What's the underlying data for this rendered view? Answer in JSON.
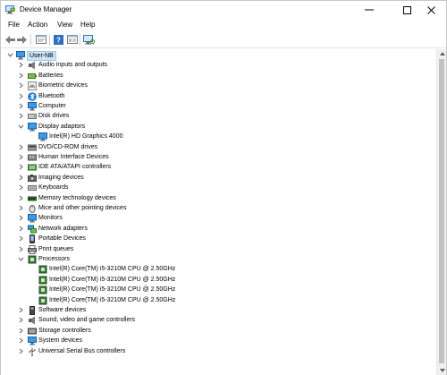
{
  "window": {
    "title": "Device Manager"
  },
  "menu": {
    "file": "File",
    "action": "Action",
    "view": "View",
    "help": "Help"
  },
  "tree": {
    "root": "User-NB",
    "categories": [
      {
        "label": "Audio inputs and outputs",
        "icon": "speaker-icon",
        "expanded": false
      },
      {
        "label": "Batteries",
        "icon": "battery-icon",
        "expanded": false
      },
      {
        "label": "Biometric devices",
        "icon": "fingerprint-icon",
        "expanded": false
      },
      {
        "label": "Bluetooth",
        "icon": "bluetooth-icon",
        "expanded": false
      },
      {
        "label": "Computer",
        "icon": "computer-icon",
        "expanded": false
      },
      {
        "label": "Disk drives",
        "icon": "disk-drive-icon",
        "expanded": false
      },
      {
        "label": "Display adaptors",
        "icon": "monitor-icon",
        "expanded": true,
        "children": [
          "Intel(R) HD Graphics 4000"
        ]
      },
      {
        "label": "DVD/CD-ROM drives",
        "icon": "optical-drive-icon",
        "expanded": false
      },
      {
        "label": "Human Interface Devices",
        "icon": "hid-icon",
        "expanded": false
      },
      {
        "label": "IDE ATA/ATAPI controllers",
        "icon": "ide-controller-icon",
        "expanded": false
      },
      {
        "label": "Imaging devices",
        "icon": "camera-icon",
        "expanded": false
      },
      {
        "label": "Keyboards",
        "icon": "keyboard-icon",
        "expanded": false
      },
      {
        "label": "Memory technology devices",
        "icon": "memory-icon",
        "expanded": false
      },
      {
        "label": "Mice and other pointing devices",
        "icon": "mouse-icon",
        "expanded": false
      },
      {
        "label": "Monitors",
        "icon": "monitor-icon",
        "expanded": false
      },
      {
        "label": "Network adapters",
        "icon": "network-icon",
        "expanded": false
      },
      {
        "label": "Portable Devices",
        "icon": "portable-device-icon",
        "expanded": false
      },
      {
        "label": "Print queues",
        "icon": "printer-icon",
        "expanded": false
      },
      {
        "label": "Processors",
        "icon": "processor-icon",
        "expanded": true,
        "children": [
          "Intel(R) Core(TM) i5-3210M CPU @ 2.50GHz",
          "Intel(R) Core(TM) i5-3210M CPU @ 2.50GHz",
          "Intel(R) Core(TM) i5-3210M CPU @ 2.50GHz",
          "Intel(R) Core(TM) i5-3210M CPU @ 2.50GHz"
        ]
      },
      {
        "label": "Software devices",
        "icon": "software-device-icon",
        "expanded": false
      },
      {
        "label": "Sound, video and game controllers",
        "icon": "speaker-icon",
        "expanded": false
      },
      {
        "label": "Storage controllers",
        "icon": "storage-controller-icon",
        "expanded": false
      },
      {
        "label": "System devices",
        "icon": "system-device-icon",
        "expanded": false
      },
      {
        "label": "Universal Serial Bus controllers",
        "icon": "usb-icon",
        "expanded": false
      }
    ]
  },
  "colors": {
    "selection": "#cce4f7",
    "selection_border": "#99c9ef",
    "accent": "#0078d7"
  }
}
